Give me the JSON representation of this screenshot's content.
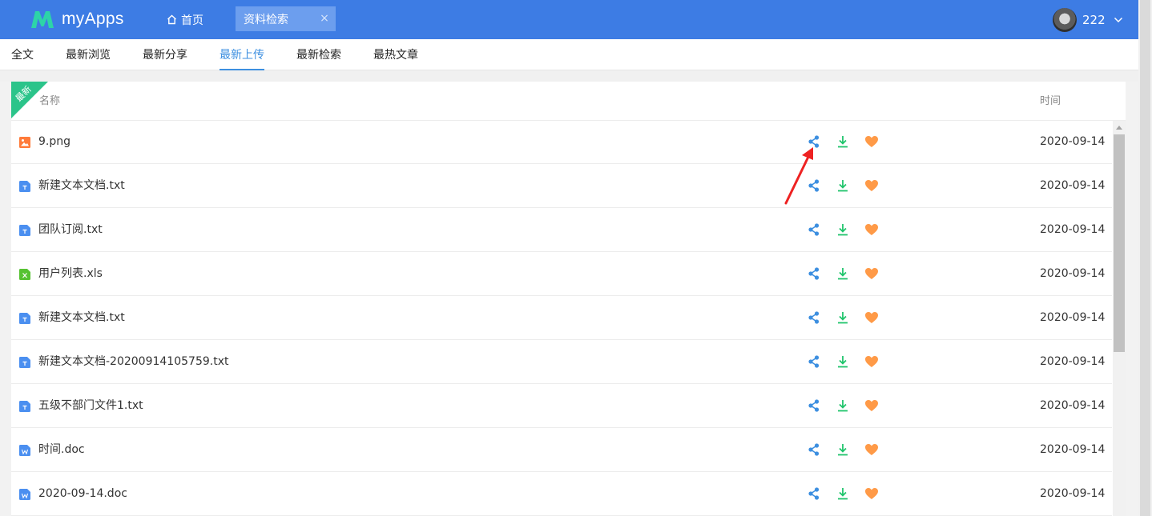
{
  "header": {
    "app_name": "myApps",
    "home_label": "首页",
    "active_tab_label": "资料检索",
    "close_glyph": "×",
    "username": "222"
  },
  "subtabs": [
    {
      "label": "全文"
    },
    {
      "label": "最新浏览"
    },
    {
      "label": "最新分享"
    },
    {
      "label": "最新上传",
      "active": true
    },
    {
      "label": "最新检索"
    },
    {
      "label": "最热文章"
    }
  ],
  "table": {
    "ribbon_label": "最新",
    "col_name": "名称",
    "col_time": "时间",
    "rows": [
      {
        "name": "9.png",
        "type": "image",
        "date": "2020-09-14"
      },
      {
        "name": "新建文本文档.txt",
        "type": "txt",
        "date": "2020-09-14"
      },
      {
        "name": "团队订阅.txt",
        "type": "txt",
        "date": "2020-09-14"
      },
      {
        "name": "用户列表.xls",
        "type": "xls",
        "date": "2020-09-14"
      },
      {
        "name": "新建文本文档.txt",
        "type": "txt",
        "date": "2020-09-14"
      },
      {
        "name": "新建文本文档-20200914105759.txt",
        "type": "txt",
        "date": "2020-09-14"
      },
      {
        "name": "五级不部门文件1.txt",
        "type": "txt",
        "date": "2020-09-14"
      },
      {
        "name": "时间.doc",
        "type": "doc",
        "date": "2020-09-14"
      },
      {
        "name": "2020-09-14.doc",
        "type": "doc",
        "date": "2020-09-14"
      }
    ],
    "row_actions": [
      "share-icon",
      "download-icon",
      "heart-icon"
    ]
  },
  "colors": {
    "header_bg": "#3d7ce4",
    "active_tab_bg": "#6c9eee",
    "subtab_active": "#3d8fe0",
    "ribbon": "#2bc48a",
    "share": "#3d8fe0",
    "download": "#1fc46b",
    "favorite": "#ff9a47",
    "annotation_arrow": "#ee2222"
  }
}
